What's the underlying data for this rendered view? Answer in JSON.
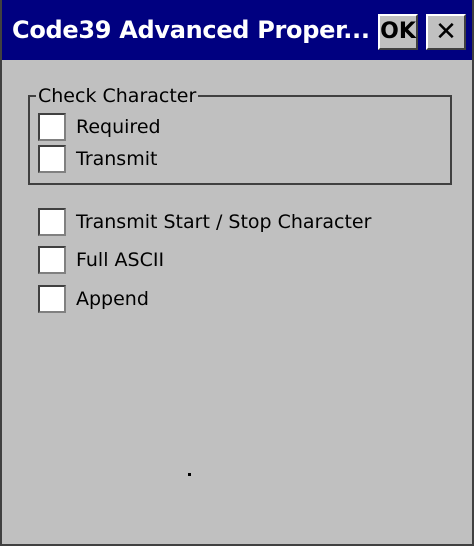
{
  "window": {
    "title": "Code39 Advanced Proper...",
    "ok_label": "OK",
    "close_label": "✕"
  },
  "check_character": {
    "legend": "Check Character",
    "options": [
      {
        "label": "Required",
        "checked": false
      },
      {
        "label": "Transmit",
        "checked": false
      }
    ]
  },
  "options": [
    {
      "label": "Transmit Start / Stop Character",
      "checked": false
    },
    {
      "label": "Full ASCII",
      "checked": false
    },
    {
      "label": "Append",
      "checked": false
    }
  ],
  "colors": {
    "titlebar": "#000080",
    "window_background": "#c0c0c0",
    "checkbox_background": "#ffffff"
  }
}
